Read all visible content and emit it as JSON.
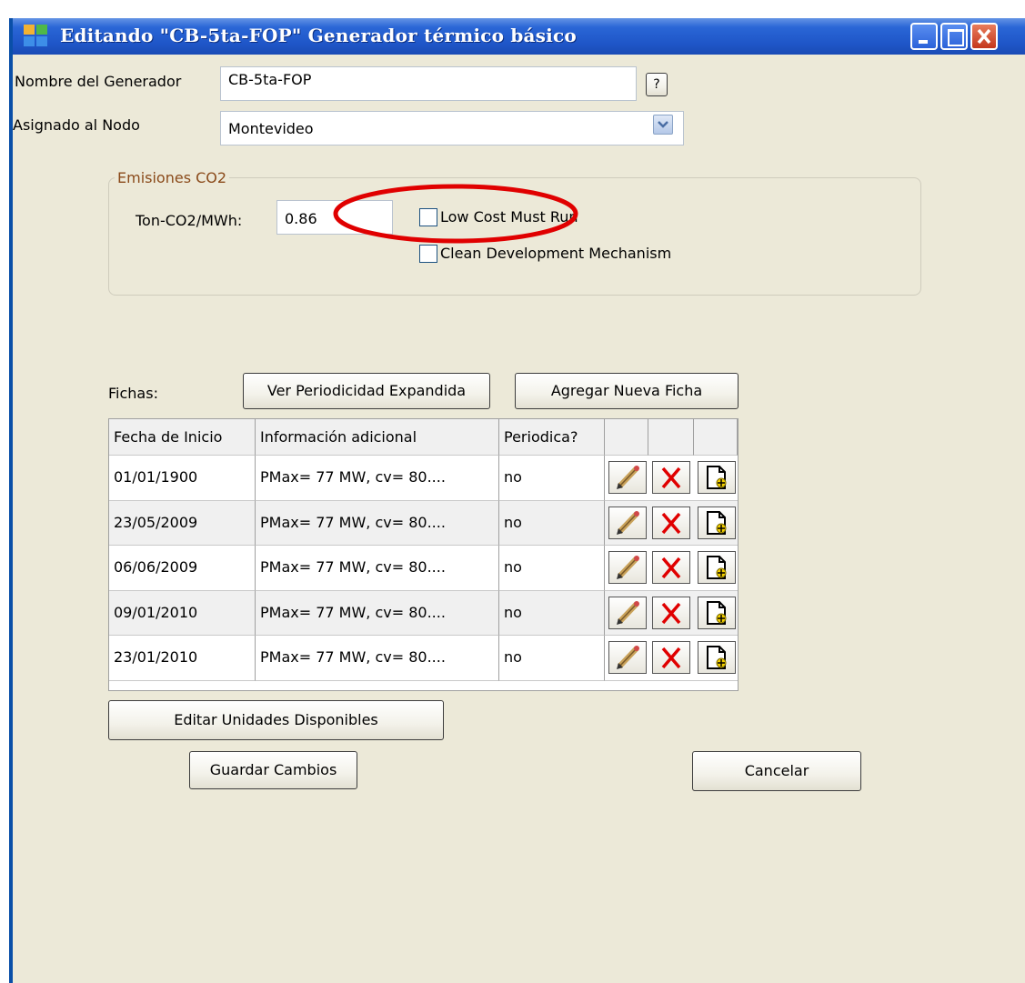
{
  "window": {
    "title": "Editando \"CB-5ta-FOP\" Generador térmico básico",
    "minimize": "minimize",
    "maximize": "maximize",
    "close": "close"
  },
  "form": {
    "nombre_label": "Nombre del Generador",
    "nombre_value": "CB-5ta-FOP",
    "help_button": "?",
    "nodo_label": "Asignado al Nodo",
    "nodo_value": "Montevideo"
  },
  "emisiones": {
    "legend": "Emisiones CO2",
    "ton_label": "Ton-CO2/MWh:",
    "ton_value": "0.86",
    "low_cost_label": "Low Cost Must Run",
    "low_cost_checked": false,
    "cdm_label": "Clean Development Mechanism",
    "cdm_checked": false,
    "highlight_color": "#e00000"
  },
  "fichas": {
    "label": "Fichas:",
    "ver_button": "Ver Periodicidad Expandida",
    "agregar_button": "Agregar Nueva Ficha",
    "columns": [
      "Fecha de Inicio",
      "Información adicional",
      "Periodica?"
    ],
    "rows": [
      {
        "fecha": "01/01/1900",
        "info": "PMax= 77 MW, cv= 80....",
        "periodica": "no"
      },
      {
        "fecha": "23/05/2009",
        "info": "PMax= 77 MW, cv= 80....",
        "periodica": "no"
      },
      {
        "fecha": "06/06/2009",
        "info": "PMax= 77 MW, cv= 80....",
        "periodica": "no"
      },
      {
        "fecha": "09/01/2010",
        "info": "PMax= 77 MW, cv= 80....",
        "periodica": "no"
      },
      {
        "fecha": "23/01/2010",
        "info": "PMax= 77 MW, cv= 80....",
        "periodica": "no"
      }
    ],
    "row_icons": [
      "pencil-icon",
      "delete-x-icon",
      "copy-add-icon"
    ]
  },
  "actions": {
    "editar_unidades": "Editar Unidades Disponibles",
    "guardar": "Guardar Cambios",
    "cancelar": "Cancelar"
  }
}
